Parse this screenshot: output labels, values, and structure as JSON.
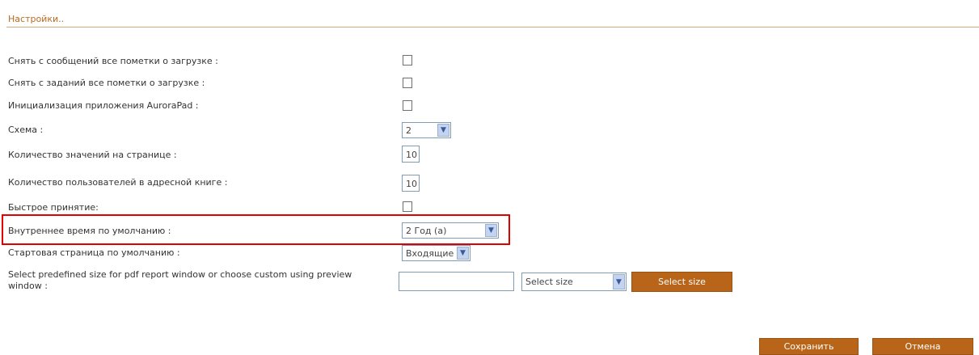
{
  "title": "Настройки..",
  "rows": {
    "clear_messages": "Снять с сообщений все пометки о загрузке :",
    "clear_tasks": "Снять с заданий все пометки о загрузке :",
    "init_app": "Инициализация приложения AuroraPad :",
    "scheme": "Схема :",
    "per_page": "Количество значений на странице :",
    "address_book": "Количество пользователей в адресной книге :",
    "quick_accept": "Быстрое принятие:",
    "internal_time": "Внутреннее время по умолчанию :",
    "start_page": "Стартовая страница по умолчанию :",
    "pdf_size_line1": "Select predefined size for pdf report window or choose custom using preview",
    "pdf_size_line2": "window :"
  },
  "values": {
    "scheme": "2",
    "per_page": "10",
    "address_book": "10",
    "internal_time": "2 Год (а)",
    "start_page": "Входящие",
    "size_select": "Select size",
    "size_custom": ""
  },
  "buttons": {
    "select_size": "Select size",
    "save": "Сохранить",
    "cancel": "Отмена"
  },
  "colors": {
    "accent": "#b8651a",
    "highlight": "#e00000"
  }
}
